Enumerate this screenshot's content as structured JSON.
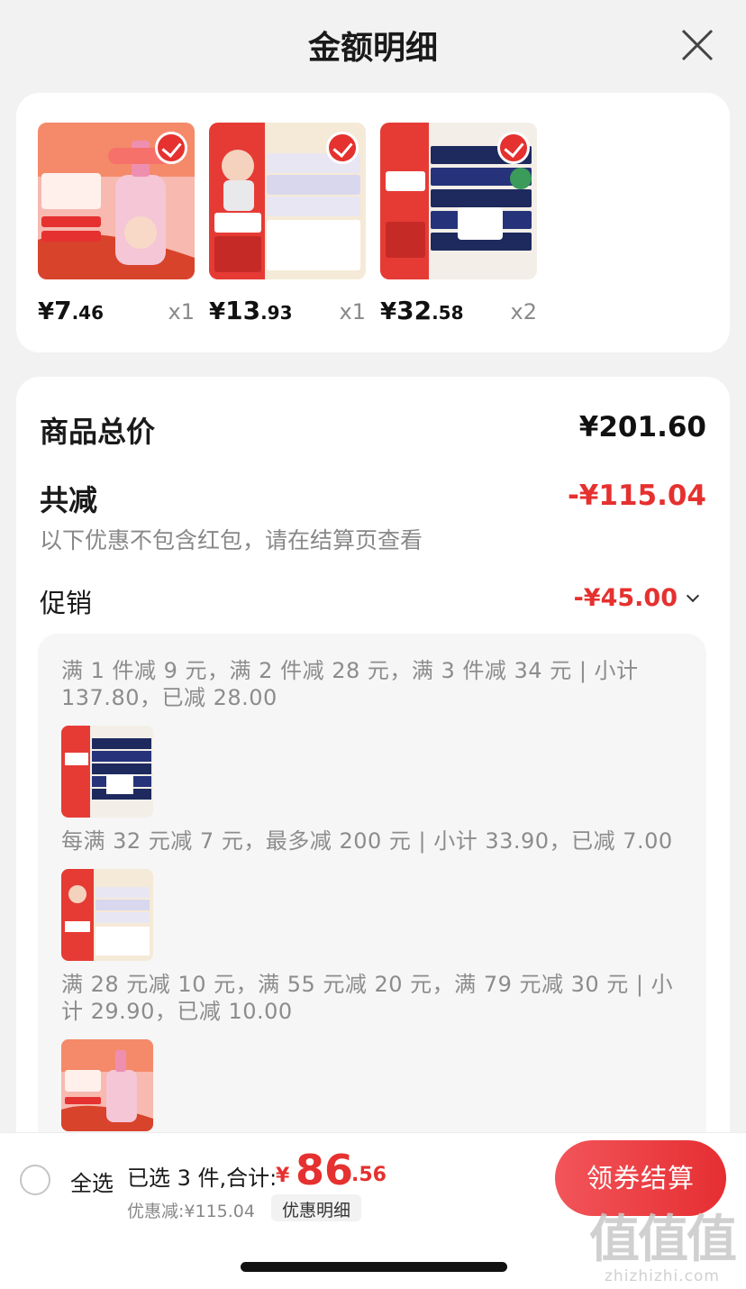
{
  "header": {
    "title": "金额明细"
  },
  "products": [
    {
      "currency": "¥",
      "price_int": "7",
      "price_dec": ".46",
      "qty": "x1",
      "image": "dish-soap"
    },
    {
      "currency": "¥",
      "price_int": "13",
      "price_dec": ".93",
      "qty": "x1",
      "image": "tissue-box"
    },
    {
      "currency": "¥",
      "price_int": "32",
      "price_dec": ".58",
      "qty": "x2",
      "image": "tissue-pack"
    }
  ],
  "summary": {
    "total_label": "商品总价",
    "total_value": "¥201.60",
    "reduce_label": "共减",
    "reduce_value": "-¥115.04",
    "note": "以下优惠不包含红包，请在结算页查看",
    "promo_label": "促销",
    "promo_value": "-¥45.00"
  },
  "promos": [
    {
      "text": "满 1 件减 9 元，满 2 件减 28 元，满 3 件减 34 元 | 小计 137.80，已减 28.00",
      "image": "tissue-pack"
    },
    {
      "text": "每满 32 元减 7 元，最多减 200 元 | 小计 33.90，已减 7.00",
      "image": "tissue-box"
    },
    {
      "text": "满 28 元减 10 元，满 55 元减 20 元，满 79 元减 30 元 | 小计 29.90，已减 10.00",
      "image": "dish-soap"
    }
  ],
  "bottom": {
    "select_all": "全选",
    "selected_info": "已选 3 件,合计:",
    "total_symbol": "¥",
    "total_int": "86",
    "total_dec": ".56",
    "discount": "优惠减:¥115.04",
    "detail_link": "优惠明细",
    "checkout": "领券结算"
  },
  "watermark": {
    "logo": "值值值",
    "url": "zhizhizhi.com"
  },
  "colors": {
    "accent": "#e5312f",
    "muted": "#8c8c8c",
    "background": "#f2f2f2"
  }
}
